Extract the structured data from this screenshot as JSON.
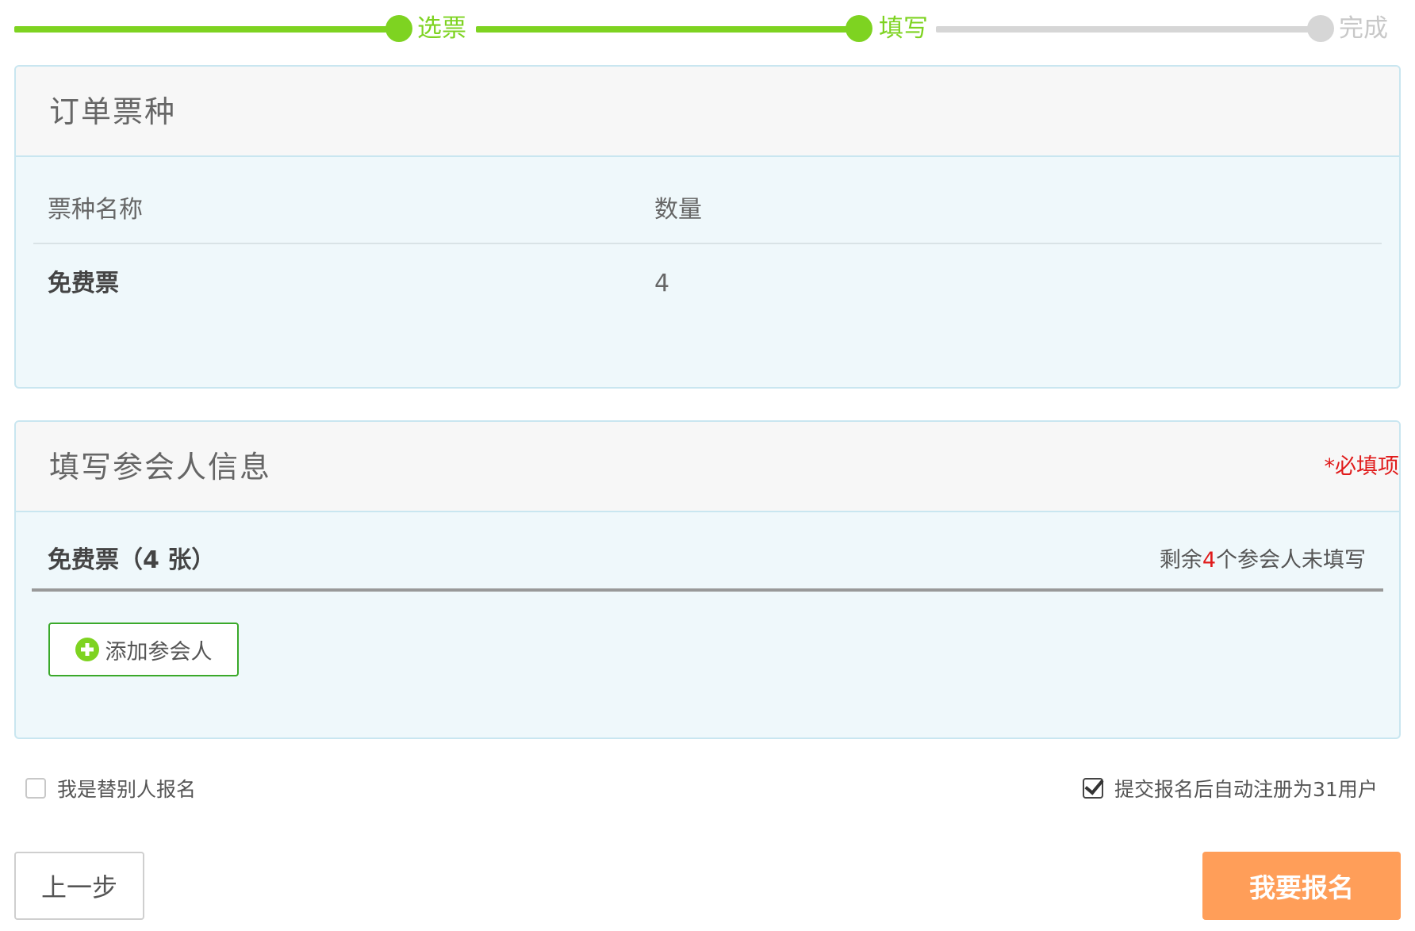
{
  "steps": [
    {
      "label": "选票",
      "state": "done"
    },
    {
      "label": "填写",
      "state": "done"
    },
    {
      "label": "完成",
      "state": "todo"
    }
  ],
  "order_panel": {
    "title": "订单票种",
    "col_name": "票种名称",
    "col_qty": "数量",
    "rows": [
      {
        "name": "免费票",
        "qty": "4"
      }
    ]
  },
  "attendee_panel": {
    "title": "填写参会人信息",
    "required_note": "*必填项",
    "ticket_label": "免费票（4 张）",
    "remain_prefix": "剩余",
    "remain_count": "4",
    "remain_suffix": "个参会人未填写",
    "add_button": "添加参会人"
  },
  "options": {
    "proxy_label": "我是替别人报名",
    "proxy_checked": false,
    "auto_register_label": "提交报名后自动注册为31用户",
    "auto_register_checked": true
  },
  "buttons": {
    "prev": "上一步",
    "submit": "我要报名"
  },
  "colors": {
    "accent_green": "#7ed321",
    "pending_gray": "#d6d6d6",
    "submit_orange": "#ff9e59",
    "required_red": "#e01b1b"
  }
}
